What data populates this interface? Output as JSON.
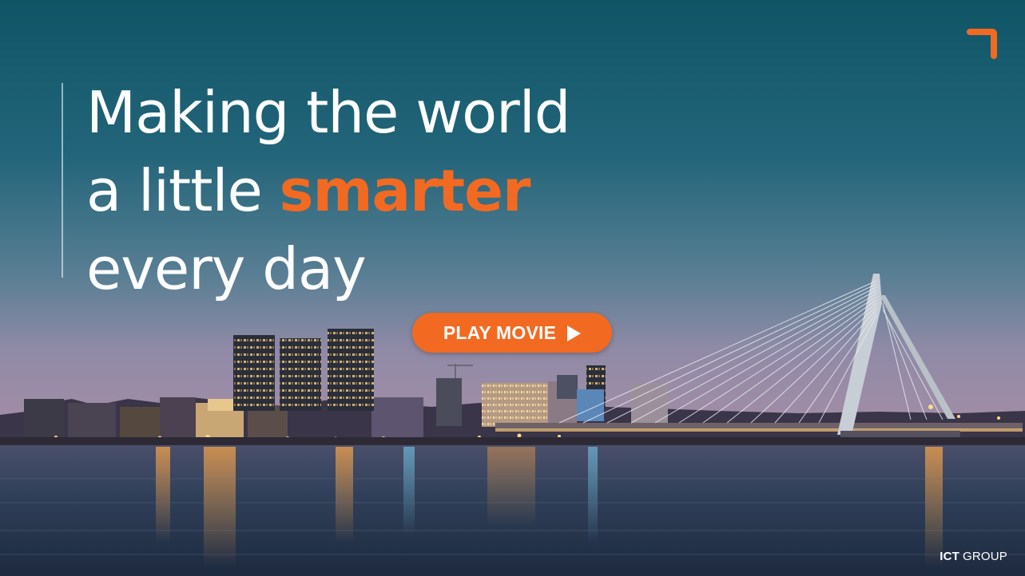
{
  "headline": {
    "line1": "Making the world",
    "line2_prefix": "a little ",
    "line2_accent": "smarter",
    "line3": "every day"
  },
  "play_button": {
    "label": "PLAY MOVIE",
    "icon": "play-icon"
  },
  "corner_logo": {
    "icon": "corner-bracket-logo"
  },
  "brand": {
    "strong": "ICT",
    "light": "GROUP"
  },
  "colors": {
    "accent": "#f26a21",
    "sky_top": "#0f5566",
    "sky_mid": "#3b6f82",
    "horizon": "#8f8aa6",
    "water": "#2b3a52",
    "text": "#ffffff"
  }
}
